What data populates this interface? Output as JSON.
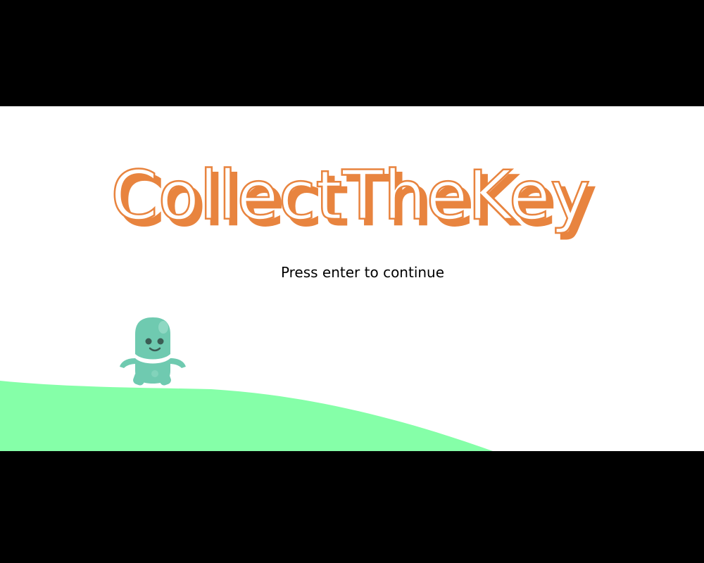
{
  "game": {
    "title": "CollectTheKey",
    "prompt": "Press enter to continue"
  },
  "colors": {
    "letterbox": "#000000",
    "canvas_background": "#ffffff",
    "title_fill": "#ffffff",
    "title_outline": "#e8843f",
    "prompt_text": "#000000",
    "ground": "#85ffa8",
    "character_body": "#6fcab0",
    "character_eyes": "#3b5c54"
  },
  "icons": {
    "character": "green-blob-character",
    "ground": "green-hill"
  }
}
